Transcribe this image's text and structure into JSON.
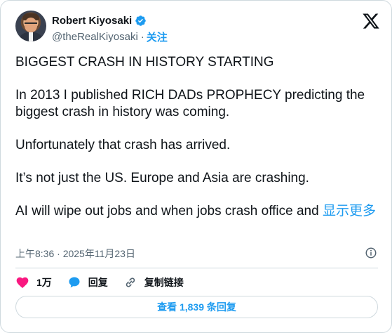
{
  "author": {
    "name": "Robert Kiyosaki",
    "handle": "@theRealKiyosaki",
    "separator": "·",
    "follow_label": "关注"
  },
  "tweet": {
    "paragraphs": [
      "BIGGEST CRASH IN HISTORY STARTING",
      "In 2013 I published RICH DADs PROPHECY predicting the biggest crash in history was coming.",
      "Unfortunately that crash has arrived.",
      "It’s not just the US.  Europe and Asia are crashing.",
      "AI will wipe out jobs and when jobs crash office and "
    ],
    "show_more_label": "显示更多"
  },
  "meta": {
    "timestamp": "上午8:36 · 2025年11月23日"
  },
  "actions": {
    "likes": "1万",
    "reply_label": "回复",
    "copy_link_label": "复制链接"
  },
  "replies_button": "查看 1,839 条回复",
  "colors": {
    "accent": "#1d9bf0",
    "like": "#f91880",
    "text": "#0f1419",
    "muted": "#536471",
    "border": "#cfd9de"
  },
  "icons": {
    "verified": "verified-badge-icon",
    "brand": "x-logo-icon",
    "info": "info-icon",
    "like": "heart-icon",
    "reply": "speech-bubble-icon",
    "copy_link": "link-icon"
  }
}
